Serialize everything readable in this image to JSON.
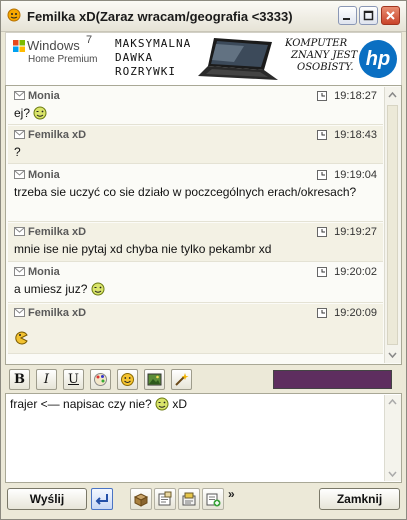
{
  "window": {
    "title": "Femilka xD(Zaraz wracam/geografia <3333)"
  },
  "banner": {
    "windows_brand": "Windows",
    "windows_version": "7",
    "windows_edition": "Home Premium",
    "slogan": [
      "MAKSYMALNA",
      "DAWKA",
      "ROZRYWKI"
    ],
    "tagline": [
      "KOMPUTER",
      "ZNANY JEST",
      "OSOBISTY."
    ],
    "hp_logo": "hp"
  },
  "messages": [
    {
      "sender": "Monia",
      "time": "19:18:27",
      "text": "ej?",
      "emoticon": "wink-smiley-icon"
    },
    {
      "sender": "Femilka xD",
      "time": "19:18:43",
      "text": "?",
      "emoticon": ""
    },
    {
      "sender": "Monia",
      "time": "19:19:04",
      "text": "trzeba sie uczyć co sie działo w poczcególnych erach/okresach?",
      "emoticon": ""
    },
    {
      "sender": "Femilka xD",
      "time": "19:19:27",
      "text": "mnie ise nie pytaj xd chyba nie tylko pekambr xd",
      "emoticon": ""
    },
    {
      "sender": "Monia",
      "time": "19:20:02",
      "text": "a umiesz juz?",
      "emoticon": "wink-smiley-icon"
    },
    {
      "sender": "Femilka xD",
      "time": "19:20:09",
      "text": "",
      "emoticon": "pacman-smiley-icon"
    }
  ],
  "toolbar": {
    "bold": "B",
    "italic": "I",
    "underline": "U",
    "text_color": "#5e2e5f"
  },
  "input": {
    "text": "frajer <— napisac czy nie?",
    "suffix": "xD"
  },
  "bottom": {
    "send_label": "Wyślij",
    "close_label": "Zamknij",
    "more": "»"
  }
}
